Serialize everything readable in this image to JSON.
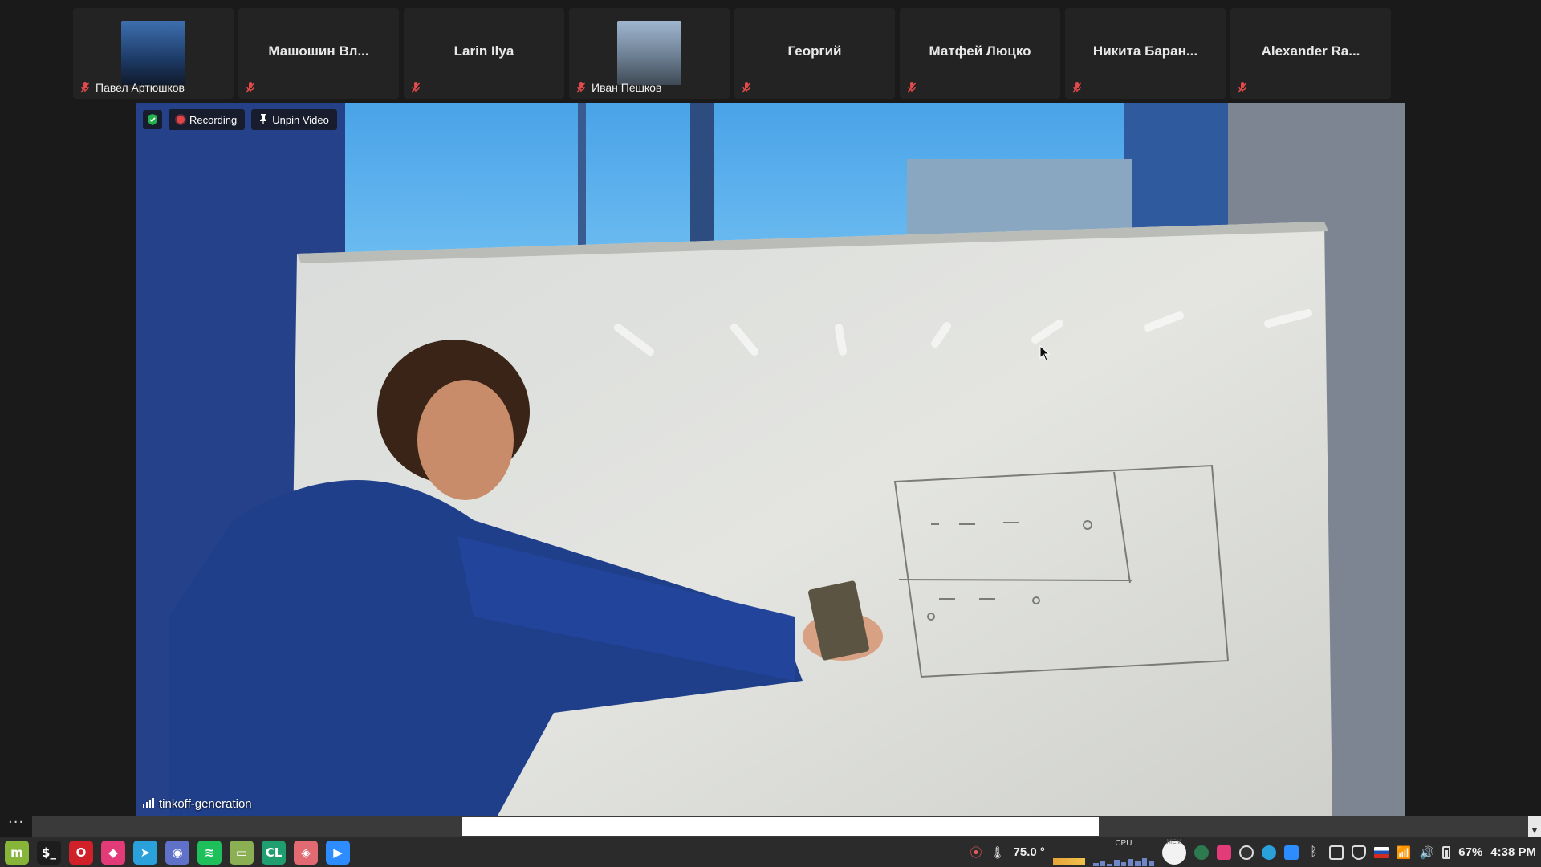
{
  "participants": [
    {
      "name": "Павел Артюшков",
      "display": "avatar",
      "label": "Павел Артюшков",
      "muted": true
    },
    {
      "name": "Машошин Вл...",
      "display": "name",
      "label": "",
      "muted": true
    },
    {
      "name": "Larin Ilya",
      "display": "name",
      "label": "",
      "muted": true
    },
    {
      "name": "Иван Пешков",
      "display": "avatar",
      "label": "Иван Пешков",
      "muted": true
    },
    {
      "name": "Георгий",
      "display": "name",
      "label": "",
      "muted": true
    },
    {
      "name": "Матфей Люцко",
      "display": "name",
      "label": "",
      "muted": true
    },
    {
      "name": "Никита Баран...",
      "display": "name",
      "label": "",
      "muted": true
    },
    {
      "name": "Alexander Ra...",
      "display": "name",
      "label": "",
      "muted": true
    }
  ],
  "video": {
    "recording_label": "Recording",
    "unpin_label": "Unpin Video",
    "speaker_name": "tinkoff-generation"
  },
  "hscroll": {
    "more_label": "···"
  },
  "taskbar": {
    "apps": [
      {
        "name": "linux-mint-menu-icon",
        "glyph": "m",
        "color": "#87b53a"
      },
      {
        "name": "terminal-icon",
        "glyph": "$_",
        "color": "#1d1d1d"
      },
      {
        "name": "opera-icon",
        "glyph": "O",
        "color": "#d0212b"
      },
      {
        "name": "jetbrains-icon",
        "glyph": "◆",
        "color": "#e33a78"
      },
      {
        "name": "telegram-icon",
        "glyph": "➤",
        "color": "#2aa1da"
      },
      {
        "name": "discord-icon",
        "glyph": "◉",
        "color": "#6071c9"
      },
      {
        "name": "spotify-icon",
        "glyph": "≋",
        "color": "#1ec05c"
      },
      {
        "name": "files-icon",
        "glyph": "▭",
        "color": "#8bb054"
      },
      {
        "name": "clion-icon",
        "glyph": "CL",
        "color": "#1f9e6f"
      },
      {
        "name": "gitkraken-icon",
        "glyph": "◈",
        "color": "#e16a73"
      },
      {
        "name": "zoom-icon",
        "glyph": "▶",
        "color": "#2d8cff"
      }
    ],
    "temperature": "75.0 °",
    "cpu_label": "CPU",
    "mem_label": "MEM",
    "battery": "67%",
    "time": "4:38 PM"
  }
}
